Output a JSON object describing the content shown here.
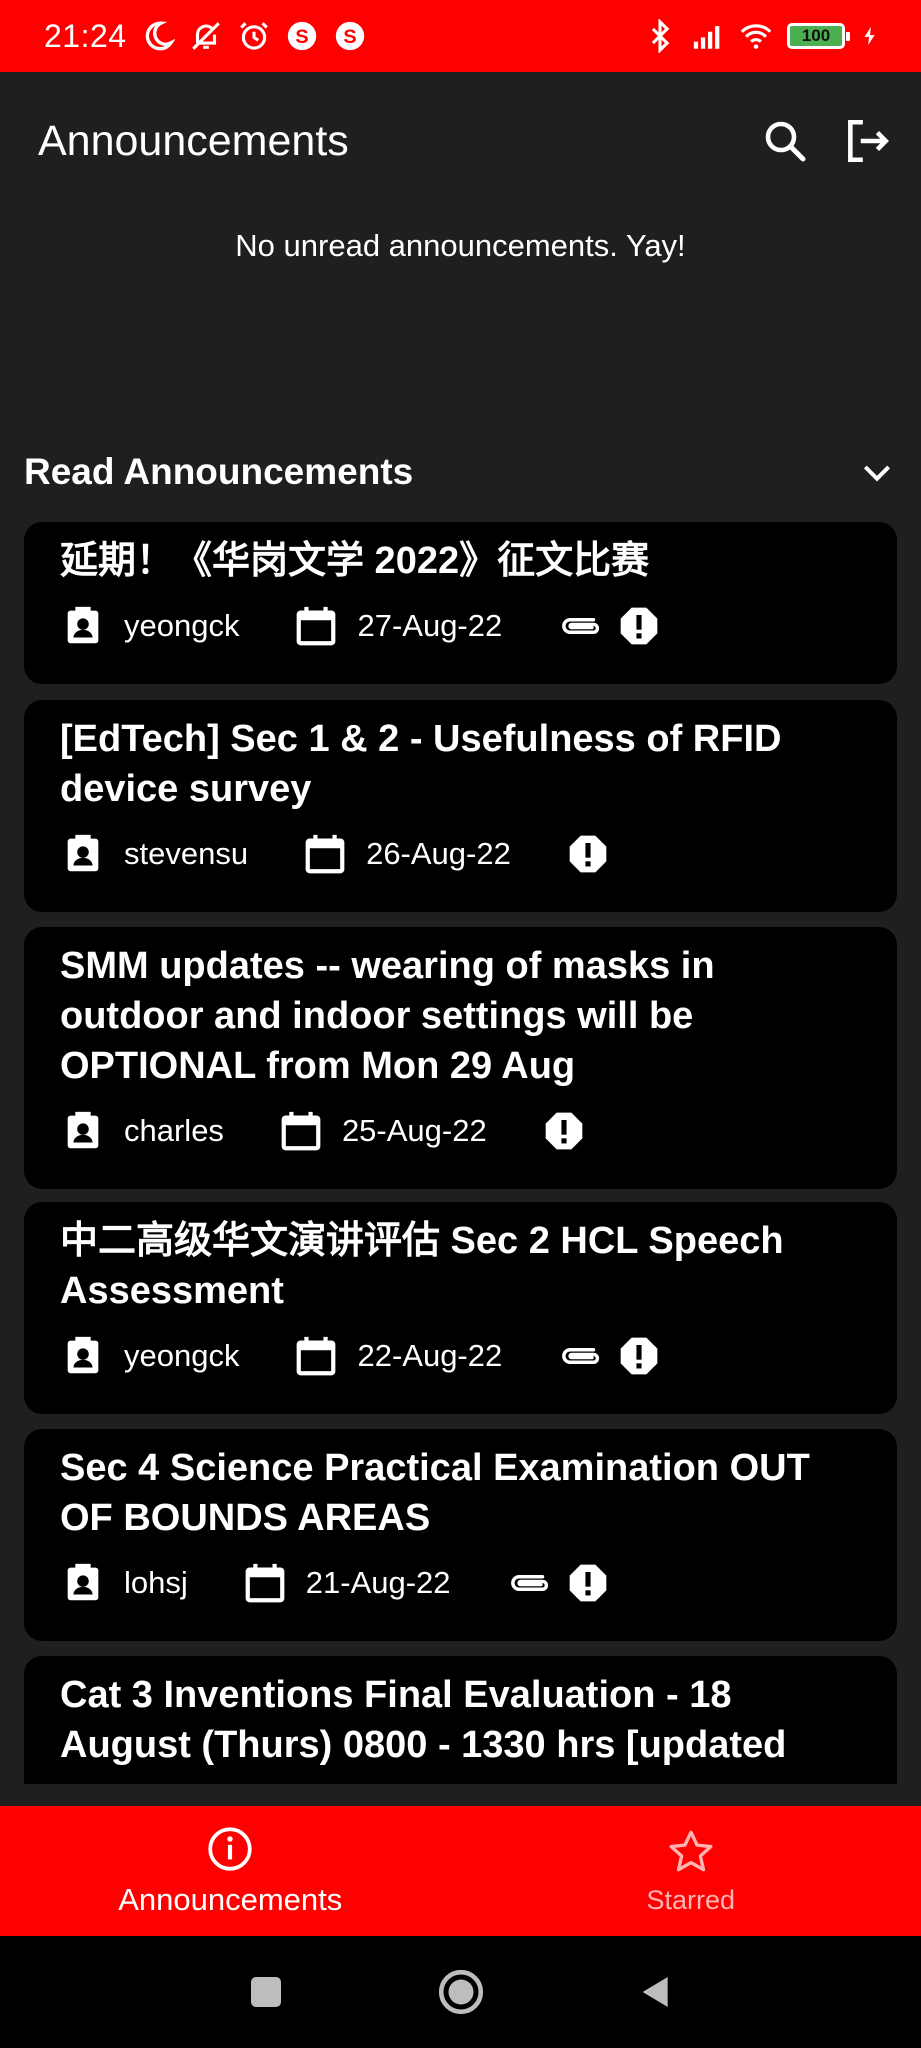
{
  "status_bar": {
    "time": "21:24",
    "battery": "100",
    "color": "#ff0000"
  },
  "header": {
    "title": "Announcements",
    "search_icon": "search-icon",
    "logout_icon": "logout-icon"
  },
  "unread": {
    "empty_message": "No unread announcements. Yay!"
  },
  "read_section": {
    "title": "Read Announcements",
    "toggle_icon": "chevron-down-icon"
  },
  "announcements": [
    {
      "title": "延期！《华岗文学 2022》征文比赛",
      "author": "yeongck",
      "date": "27-Aug-22",
      "attachment": true,
      "important": true
    },
    {
      "title": "[EdTech] Sec 1 & 2 - Usefulness of RFID device survey",
      "author": "stevensu",
      "date": "26-Aug-22",
      "attachment": false,
      "important": true
    },
    {
      "title": "SMM updates -- wearing of masks in outdoor and indoor settings will be OPTIONAL from Mon 29 Aug",
      "author": "charles",
      "date": "25-Aug-22",
      "attachment": false,
      "important": true
    },
    {
      "title": "中二高级华文演讲评估 Sec 2 HCL Speech Assessment",
      "author": "yeongck",
      "date": "22-Aug-22",
      "attachment": true,
      "important": true
    },
    {
      "title": "Sec 4 Science Practical Examination OUT OF BOUNDS AREAS",
      "author": "lohsj",
      "date": "21-Aug-22",
      "attachment": true,
      "important": true
    },
    {
      "title": "Cat 3 Inventions Final Evaluation - 18 August (Thurs) 0800 - 1330 hrs [updated",
      "author": "",
      "date": "",
      "attachment": false,
      "important": false
    }
  ],
  "bottom_nav": {
    "items": [
      {
        "label": "Announcements",
        "icon": "info-icon",
        "active": true
      },
      {
        "label": "Starred",
        "icon": "star-icon",
        "active": false
      }
    ]
  },
  "colors": {
    "accent": "#ff0000",
    "background": "#1f1f1f",
    "card": "#000000"
  }
}
